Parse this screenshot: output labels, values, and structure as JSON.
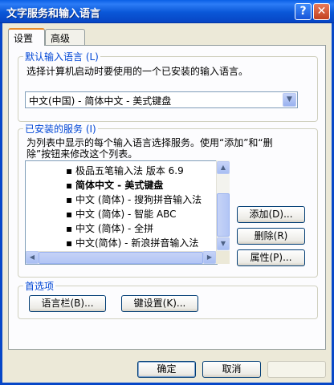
{
  "window": {
    "title": "文字服务和输入语言",
    "help_glyph": "?",
    "close_glyph": "✕"
  },
  "tabs": [
    {
      "label": "设置",
      "active": true
    },
    {
      "label": "高级",
      "active": false
    }
  ],
  "default_lang": {
    "legend": "默认输入语言 (L)",
    "desc": "选择计算机启动时要使用的一个已安装的输入语言。",
    "selected": "中文(中国) - 简体中文 - 美式键盘"
  },
  "installed": {
    "legend": "已安装的服务 (I)",
    "desc_line1": "为列表中显示的每个输入语言选择服务。使用“添加”和“删",
    "desc_line2": "除”按钮来修改这个列表。",
    "items": [
      {
        "text": "极品五笔输入法 版本 6.9",
        "bold": false,
        "selected": false
      },
      {
        "text": "简体中文 - 美式键盘",
        "bold": true,
        "selected": false
      },
      {
        "text": "中文 (简体) - 搜狗拼音输入法",
        "bold": false,
        "selected": false
      },
      {
        "text": "中文 (简体) - 智能 ABC",
        "bold": false,
        "selected": false
      },
      {
        "text": "中文 (简体) - 全拼",
        "bold": false,
        "selected": false
      },
      {
        "text": "中文(简体) - 新浪拼音输入法",
        "bold": false,
        "selected": true
      }
    ],
    "add_label": "添加(D)...",
    "remove_label": "删除(R)",
    "props_label": "属性(P)..."
  },
  "prefs": {
    "legend": "首选项",
    "langbar_label": "语言栏(B)...",
    "keys_label": "键设置(K)..."
  },
  "footer": {
    "ok_label": "确定",
    "cancel_label": "取消",
    "apply_label": ""
  }
}
